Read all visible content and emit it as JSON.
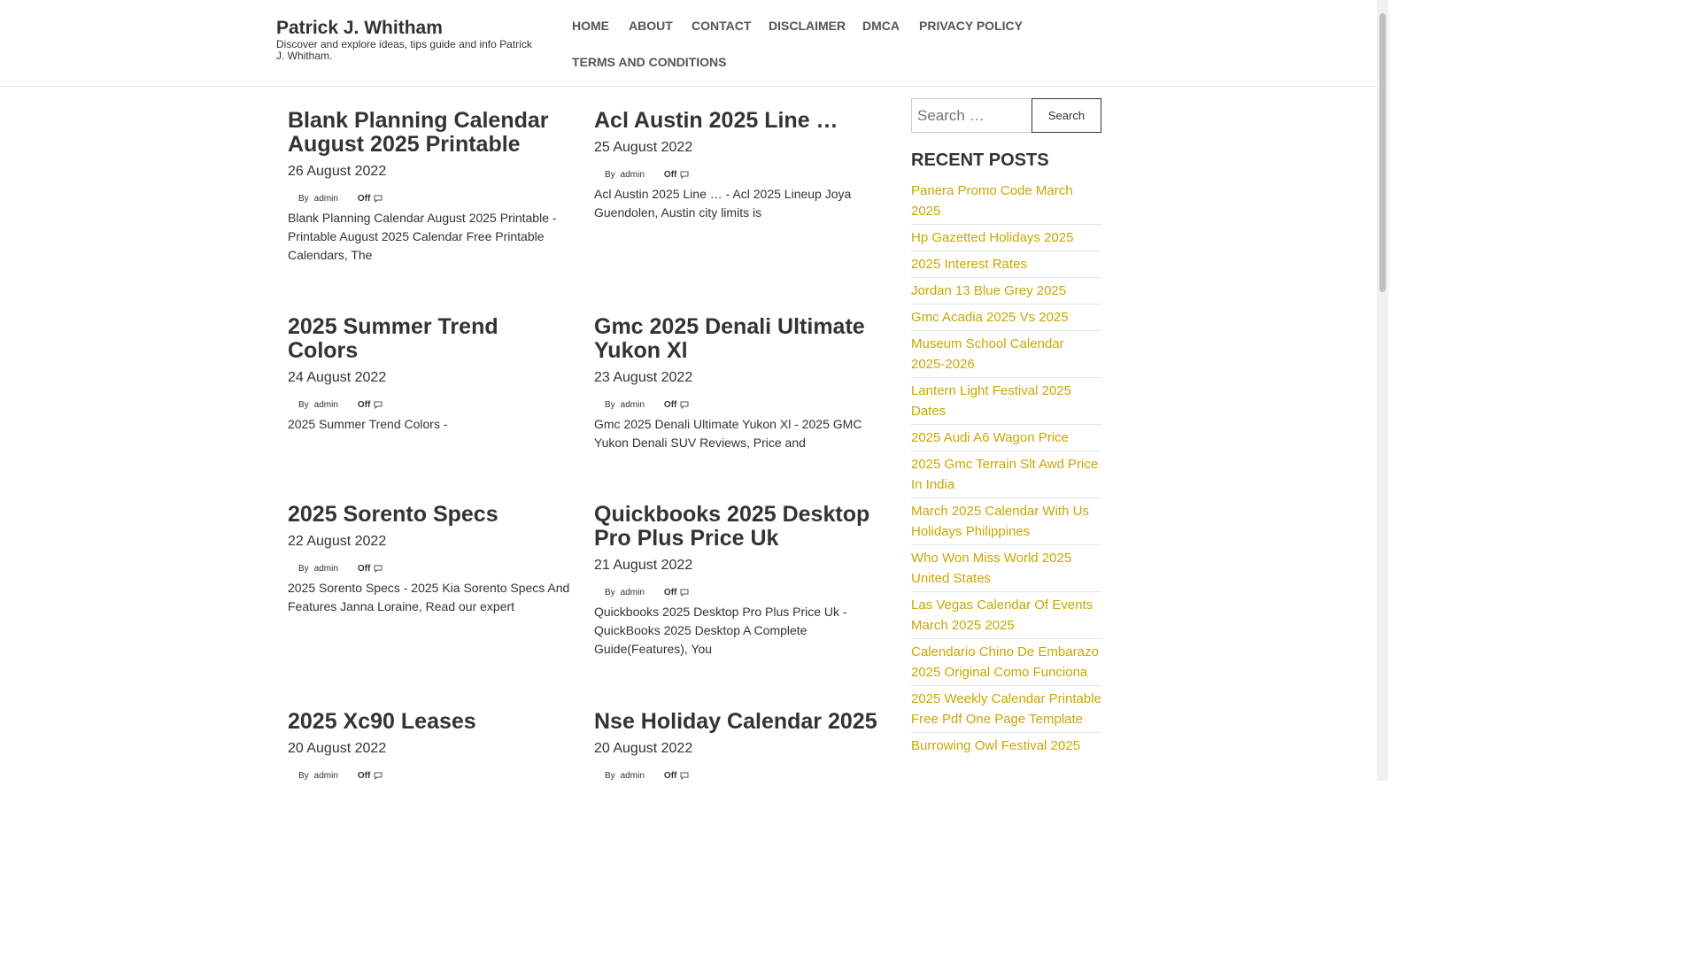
{
  "site": {
    "title": "Patrick J. Whitham",
    "description": "Discover and explore ideas, tips guide and info Patrick J. Whitham."
  },
  "nav": {
    "items": [
      "HOME",
      "ABOUT",
      "CONTACT",
      "DISCLAIMER",
      "DMCA",
      "PRIVACY POLICY",
      "TERMS AND CONDITIONS"
    ]
  },
  "posts": [
    {
      "title": "Blank Planning Calendar August 2025 Printable",
      "date": "26 August 2022",
      "by": "By",
      "author": "admin",
      "comments": "Off",
      "excerpt": "Blank Planning Calendar August 2025 Printable - Printable August 2025 Calendar Free Printable Calendars, The"
    },
    {
      "title": "Acl Austin 2025 Line …",
      "date": "25 August 2022",
      "by": "By",
      "author": "admin",
      "comments": "Off",
      "excerpt": "Acl Austin 2025 Line … - Acl 2025 Lineup Joya Guendolen, Austin city limits is"
    },
    {
      "title": "2025 Summer Trend Colors",
      "date": "24 August 2022",
      "by": "By",
      "author": "admin",
      "comments": "Off",
      "excerpt": "2025 Summer Trend Colors -"
    },
    {
      "title": "Gmc 2025 Denali Ultimate Yukon Xl",
      "date": "23 August 2022",
      "by": "By",
      "author": "admin",
      "comments": "Off",
      "excerpt": "Gmc 2025 Denali Ultimate Yukon Xl - 2025 GMC Yukon Denali SUV Reviews, Price and"
    },
    {
      "title": "2025 Sorento Specs",
      "date": "22 August 2022",
      "by": "By",
      "author": "admin",
      "comments": "Off",
      "excerpt": "2025 Sorento Specs - 2025 Kia Sorento Specs And Features Janna Loraine, Read our expert"
    },
    {
      "title": "Quickbooks 2025 Desktop Pro Plus Price Uk",
      "date": "21 August 2022",
      "by": "By",
      "author": "admin",
      "comments": "Off",
      "excerpt": "Quickbooks 2025 Desktop Pro Plus Price Uk - QuickBooks 2025 Desktop A Complete Guide(Features), You"
    },
    {
      "title": "2025 Xc90 Leases",
      "date": "20 August 2022",
      "by": "By",
      "author": "admin",
      "comments": "Off",
      "excerpt": ""
    },
    {
      "title": "Nse Holiday Calendar 2025",
      "date": "20 August 2022",
      "by": "By",
      "author": "admin",
      "comments": "Off",
      "excerpt": ""
    }
  ],
  "search": {
    "placeholder": "Search …",
    "button_label": "Search"
  },
  "sidebar": {
    "recent_title": "RECENT POSTS",
    "recent_posts": [
      "Panera Promo Code March 2025",
      "Hp Gazetted Holidays 2025",
      "2025 Interest Rates",
      "Jordan 13 Blue Grey 2025",
      "Gmc Acadia 2025 Vs 2025",
      "Museum School Calendar 2025-2026",
      "Lantern Light Festival 2025 Dates",
      "2025 Audi A6 Wagon Price",
      "2025 Gmc Terrain Slt Awd Price In India",
      "March 2025 Calendar With Us Holidays Philippines",
      "Who Won Miss World 2025 United States",
      "Las Vegas Calendar Of Events March 2025 2025",
      "Calendario Chino De Embarazo 2025 Original Como Funciona",
      "2025 Weekly Calendar Printable Free Pdf One Page Template",
      "Burrowing Owl Festival 2025"
    ]
  },
  "colors": {
    "link_accent": "#c9a700",
    "text": "#333333"
  }
}
